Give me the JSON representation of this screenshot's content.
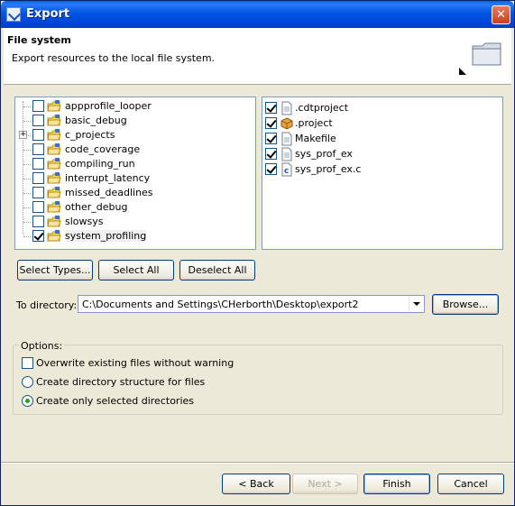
{
  "window": {
    "title": "Export"
  },
  "header": {
    "title": "File system",
    "description": "Export resources to the local file system."
  },
  "projects": [
    {
      "label": "appprofile_looper",
      "checked": false,
      "expandable": false
    },
    {
      "label": "basic_debug",
      "checked": false,
      "expandable": false
    },
    {
      "label": "c_projects",
      "checked": false,
      "expandable": true
    },
    {
      "label": "code_coverage",
      "checked": false,
      "expandable": false
    },
    {
      "label": "compiling_run",
      "checked": false,
      "expandable": false
    },
    {
      "label": "interrupt_latency",
      "checked": false,
      "expandable": false
    },
    {
      "label": "missed_deadlines",
      "checked": false,
      "expandable": false
    },
    {
      "label": "other_debug",
      "checked": false,
      "expandable": false
    },
    {
      "label": "slowsys",
      "checked": false,
      "expandable": false
    },
    {
      "label": "system_profiling",
      "checked": true,
      "expandable": false
    }
  ],
  "files": [
    {
      "label": ".cdtproject",
      "checked": true,
      "icon": "file-icon"
    },
    {
      "label": ".project",
      "checked": true,
      "icon": "project-file-icon"
    },
    {
      "label": "Makefile",
      "checked": true,
      "icon": "file-icon"
    },
    {
      "label": "sys_prof_ex",
      "checked": true,
      "icon": "file-icon"
    },
    {
      "label": "sys_prof_ex.c",
      "checked": true,
      "icon": "c-source-icon"
    }
  ],
  "selection_buttons": {
    "select_types": "Select Types...",
    "select_all": "Select All",
    "deselect_all": "Deselect All"
  },
  "directory": {
    "label": "To directory:",
    "value": "C:\\Documents and Settings\\CHerborth\\Desktop\\export2",
    "browse": "Browse..."
  },
  "options": {
    "title": "Options:",
    "overwrite": {
      "label": "Overwrite existing files without warning",
      "checked": false
    },
    "create_structure": {
      "label": "Create directory structure for files",
      "selected": false
    },
    "create_selected": {
      "label": "Create only selected directories",
      "selected": true
    }
  },
  "footer": {
    "back": "< Back",
    "next": "Next >",
    "finish": "Finish",
    "cancel": "Cancel"
  },
  "colors": {
    "titlebar": "#0055e5",
    "dialog_bg": "#ece9d8",
    "check_green": "#21a121"
  }
}
